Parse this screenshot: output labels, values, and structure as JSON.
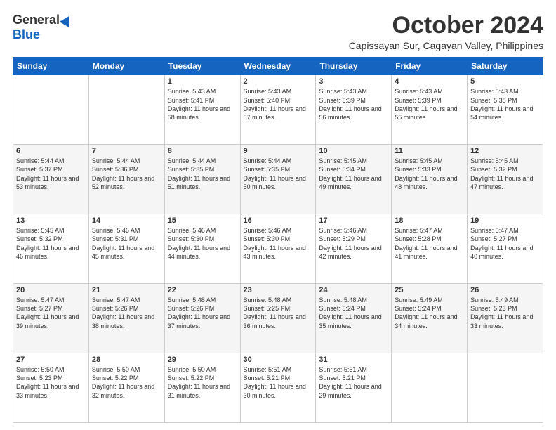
{
  "header": {
    "logo_general": "General",
    "logo_blue": "Blue",
    "month": "October 2024",
    "location": "Capissayan Sur, Cagayan Valley, Philippines"
  },
  "weekdays": [
    "Sunday",
    "Monday",
    "Tuesday",
    "Wednesday",
    "Thursday",
    "Friday",
    "Saturday"
  ],
  "weeks": [
    [
      {
        "day": "",
        "content": ""
      },
      {
        "day": "",
        "content": ""
      },
      {
        "day": "1",
        "content": "Sunrise: 5:43 AM\nSunset: 5:41 PM\nDaylight: 11 hours and 58 minutes."
      },
      {
        "day": "2",
        "content": "Sunrise: 5:43 AM\nSunset: 5:40 PM\nDaylight: 11 hours and 57 minutes."
      },
      {
        "day": "3",
        "content": "Sunrise: 5:43 AM\nSunset: 5:39 PM\nDaylight: 11 hours and 56 minutes."
      },
      {
        "day": "4",
        "content": "Sunrise: 5:43 AM\nSunset: 5:39 PM\nDaylight: 11 hours and 55 minutes."
      },
      {
        "day": "5",
        "content": "Sunrise: 5:43 AM\nSunset: 5:38 PM\nDaylight: 11 hours and 54 minutes."
      }
    ],
    [
      {
        "day": "6",
        "content": "Sunrise: 5:44 AM\nSunset: 5:37 PM\nDaylight: 11 hours and 53 minutes."
      },
      {
        "day": "7",
        "content": "Sunrise: 5:44 AM\nSunset: 5:36 PM\nDaylight: 11 hours and 52 minutes."
      },
      {
        "day": "8",
        "content": "Sunrise: 5:44 AM\nSunset: 5:35 PM\nDaylight: 11 hours and 51 minutes."
      },
      {
        "day": "9",
        "content": "Sunrise: 5:44 AM\nSunset: 5:35 PM\nDaylight: 11 hours and 50 minutes."
      },
      {
        "day": "10",
        "content": "Sunrise: 5:45 AM\nSunset: 5:34 PM\nDaylight: 11 hours and 49 minutes."
      },
      {
        "day": "11",
        "content": "Sunrise: 5:45 AM\nSunset: 5:33 PM\nDaylight: 11 hours and 48 minutes."
      },
      {
        "day": "12",
        "content": "Sunrise: 5:45 AM\nSunset: 5:32 PM\nDaylight: 11 hours and 47 minutes."
      }
    ],
    [
      {
        "day": "13",
        "content": "Sunrise: 5:45 AM\nSunset: 5:32 PM\nDaylight: 11 hours and 46 minutes."
      },
      {
        "day": "14",
        "content": "Sunrise: 5:46 AM\nSunset: 5:31 PM\nDaylight: 11 hours and 45 minutes."
      },
      {
        "day": "15",
        "content": "Sunrise: 5:46 AM\nSunset: 5:30 PM\nDaylight: 11 hours and 44 minutes."
      },
      {
        "day": "16",
        "content": "Sunrise: 5:46 AM\nSunset: 5:30 PM\nDaylight: 11 hours and 43 minutes."
      },
      {
        "day": "17",
        "content": "Sunrise: 5:46 AM\nSunset: 5:29 PM\nDaylight: 11 hours and 42 minutes."
      },
      {
        "day": "18",
        "content": "Sunrise: 5:47 AM\nSunset: 5:28 PM\nDaylight: 11 hours and 41 minutes."
      },
      {
        "day": "19",
        "content": "Sunrise: 5:47 AM\nSunset: 5:27 PM\nDaylight: 11 hours and 40 minutes."
      }
    ],
    [
      {
        "day": "20",
        "content": "Sunrise: 5:47 AM\nSunset: 5:27 PM\nDaylight: 11 hours and 39 minutes."
      },
      {
        "day": "21",
        "content": "Sunrise: 5:47 AM\nSunset: 5:26 PM\nDaylight: 11 hours and 38 minutes."
      },
      {
        "day": "22",
        "content": "Sunrise: 5:48 AM\nSunset: 5:26 PM\nDaylight: 11 hours and 37 minutes."
      },
      {
        "day": "23",
        "content": "Sunrise: 5:48 AM\nSunset: 5:25 PM\nDaylight: 11 hours and 36 minutes."
      },
      {
        "day": "24",
        "content": "Sunrise: 5:48 AM\nSunset: 5:24 PM\nDaylight: 11 hours and 35 minutes."
      },
      {
        "day": "25",
        "content": "Sunrise: 5:49 AM\nSunset: 5:24 PM\nDaylight: 11 hours and 34 minutes."
      },
      {
        "day": "26",
        "content": "Sunrise: 5:49 AM\nSunset: 5:23 PM\nDaylight: 11 hours and 33 minutes."
      }
    ],
    [
      {
        "day": "27",
        "content": "Sunrise: 5:50 AM\nSunset: 5:23 PM\nDaylight: 11 hours and 33 minutes."
      },
      {
        "day": "28",
        "content": "Sunrise: 5:50 AM\nSunset: 5:22 PM\nDaylight: 11 hours and 32 minutes."
      },
      {
        "day": "29",
        "content": "Sunrise: 5:50 AM\nSunset: 5:22 PM\nDaylight: 11 hours and 31 minutes."
      },
      {
        "day": "30",
        "content": "Sunrise: 5:51 AM\nSunset: 5:21 PM\nDaylight: 11 hours and 30 minutes."
      },
      {
        "day": "31",
        "content": "Sunrise: 5:51 AM\nSunset: 5:21 PM\nDaylight: 11 hours and 29 minutes."
      },
      {
        "day": "",
        "content": ""
      },
      {
        "day": "",
        "content": ""
      }
    ]
  ]
}
